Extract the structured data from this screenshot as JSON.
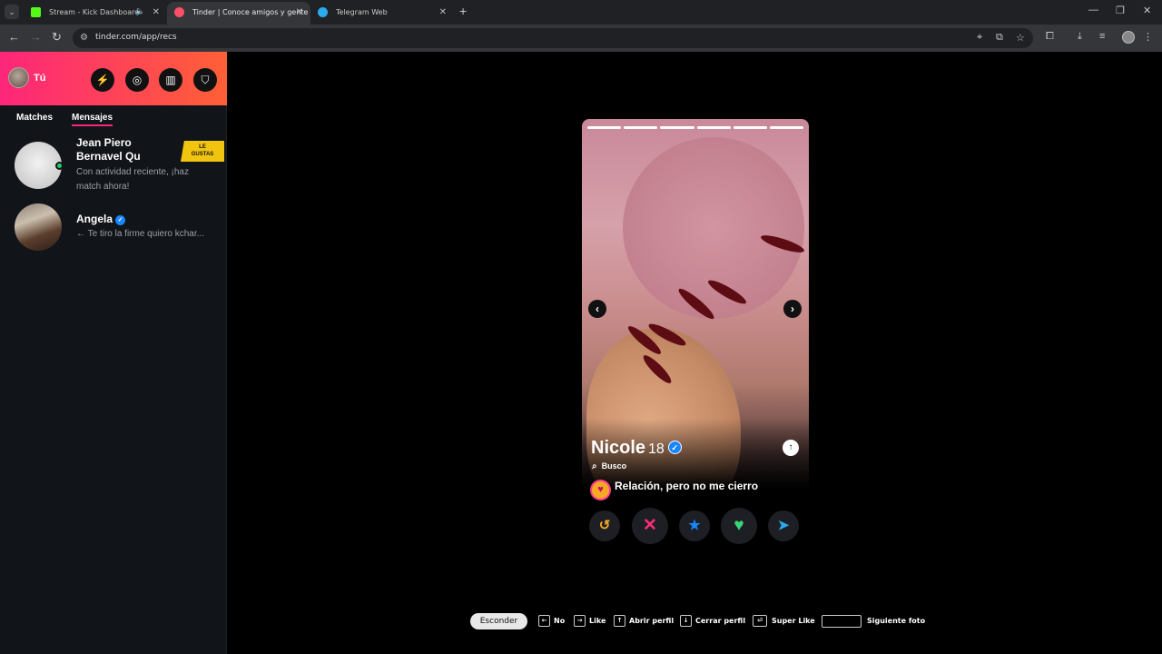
{
  "browser": {
    "tabs": [
      {
        "title": "Stream - Kick Dashboard",
        "fav_color": "#53fc18"
      },
      {
        "title": "Tinder | Conoce amigos y gente",
        "fav_color": "#fd5068"
      },
      {
        "title": "Telegram Web",
        "fav_color": "#2aabee"
      }
    ],
    "url": "tinder.com/app/recs"
  },
  "sidebar": {
    "me_label": "Tú",
    "tabs": [
      "Matches",
      "Mensajes"
    ],
    "conversations": [
      {
        "name": "Jean Piero Bernavel Qu",
        "message": "Con actividad reciente, ¡haz match ahora!",
        "badge_line1": "LE",
        "badge_line2": "GUSTAS",
        "online": true
      },
      {
        "name": "Angela",
        "message": "← Te tiro la firme quiero kchar...",
        "verified": true
      }
    ]
  },
  "profile": {
    "name": "Nicole",
    "age": "18",
    "looking_label": "Busco",
    "intent": "Relación, pero no me cierro",
    "photo_count": 6,
    "current_photo": 6
  },
  "actions": [
    "rewind",
    "nope",
    "super-like",
    "like",
    "boost"
  ],
  "hotkeys": {
    "hide_label": "Esconder",
    "items": [
      {
        "label": "No",
        "key": "←"
      },
      {
        "label": "Like",
        "key": "→"
      },
      {
        "label": "Abrir perfil",
        "key": "↑"
      },
      {
        "label": "Cerrar perfil",
        "key": "↓"
      },
      {
        "label": "Super Like",
        "key": "⏎"
      },
      {
        "label": "Siguiente foto",
        "key": ""
      }
    ]
  },
  "colors": {
    "brand_start": "#fd267a",
    "brand_end": "#ff6036",
    "nope": "#ff2d76",
    "super_like": "#1786ff",
    "like": "#37d67a",
    "boost": "#2aabee",
    "rewind": "#f5a623"
  }
}
